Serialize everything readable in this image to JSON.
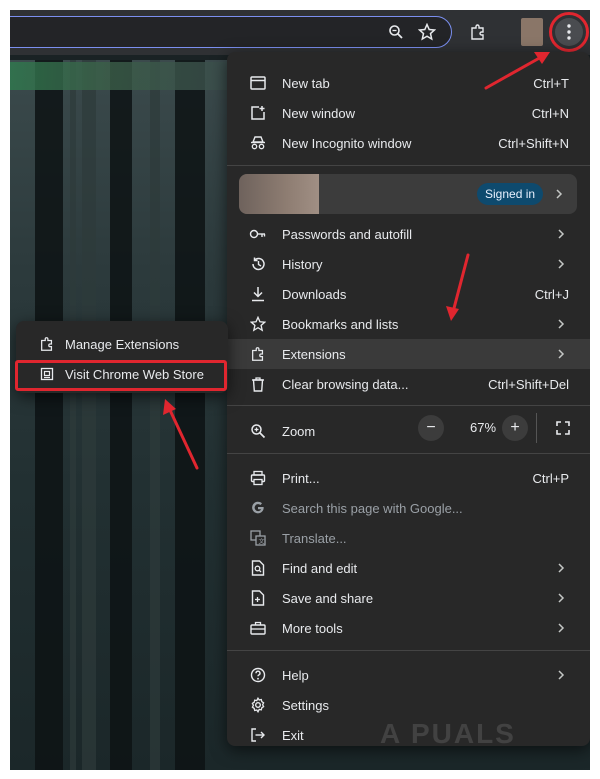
{
  "menu": {
    "new_tab": {
      "label": "New tab",
      "shortcut": "Ctrl+T"
    },
    "new_window": {
      "label": "New window",
      "shortcut": "Ctrl+N"
    },
    "new_incognito": {
      "label": "New Incognito window",
      "shortcut": "Ctrl+Shift+N"
    },
    "profile": {
      "badge": "Signed in"
    },
    "passwords": {
      "label": "Passwords and autofill"
    },
    "history": {
      "label": "History"
    },
    "downloads": {
      "label": "Downloads",
      "shortcut": "Ctrl+J"
    },
    "bookmarks": {
      "label": "Bookmarks and lists"
    },
    "extensions": {
      "label": "Extensions"
    },
    "clear_data": {
      "label": "Clear browsing data...",
      "shortcut": "Ctrl+Shift+Del"
    },
    "zoom": {
      "label": "Zoom",
      "value": "67%",
      "minus": "−",
      "plus": "+"
    },
    "print": {
      "label": "Print...",
      "shortcut": "Ctrl+P"
    },
    "search_google": {
      "label": "Search this page with Google..."
    },
    "translate": {
      "label": "Translate..."
    },
    "find_edit": {
      "label": "Find and edit"
    },
    "save_share": {
      "label": "Save and share"
    },
    "more_tools": {
      "label": "More tools"
    },
    "help": {
      "label": "Help"
    },
    "settings": {
      "label": "Settings"
    },
    "exit": {
      "label": "Exit"
    }
  },
  "submenu": {
    "manage_extensions": "Manage Extensions",
    "visit_store": "Visit Chrome Web Store"
  },
  "watermark": "A  PUALS",
  "colors": {
    "annotation": "#e0262f",
    "menu_bg": "#282828",
    "badge_bg": "#0e4a6e"
  }
}
